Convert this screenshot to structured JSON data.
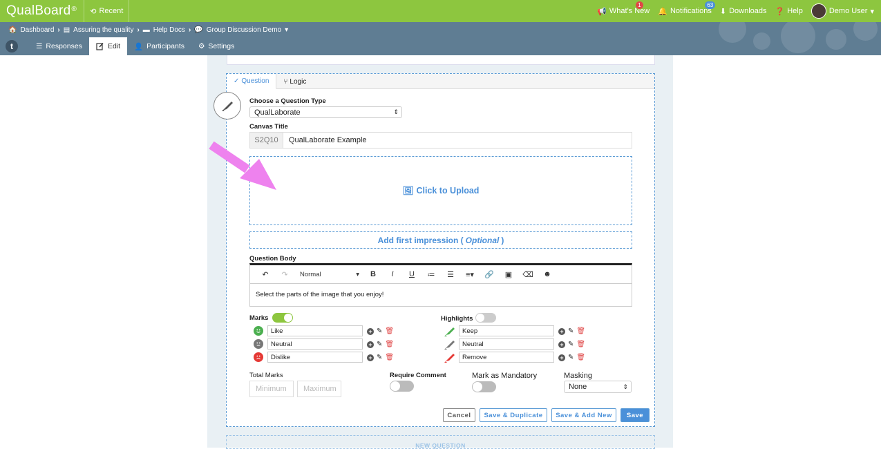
{
  "app": {
    "logo": "QualBoard",
    "logo_mark": "®",
    "recent": "Recent"
  },
  "topnav": {
    "whats_new": "What's New",
    "whats_new_badge": "1",
    "notifications": "Notifications",
    "notifications_badge": "63",
    "downloads": "Downloads",
    "help": "Help",
    "user": "Demo User"
  },
  "breadcrumb": [
    "Dashboard",
    "Assuring the quality",
    "Help Docs",
    "Group Discussion Demo"
  ],
  "tabs": {
    "logo_letter": "t",
    "responses": "Responses",
    "edit": "Edit",
    "participants": "Participants",
    "settings": "Settings"
  },
  "question": {
    "tabs": [
      "Question",
      "Logic"
    ],
    "type_label": "Choose a Question Type",
    "type_value": "QualLaborate",
    "title_label": "Canvas Title",
    "title_prefix": "S2Q10",
    "title_value": "QualLaborate Example",
    "upload": "Click to Upload",
    "impression_prefix": "Add first impression (",
    "impression_optional": "Optional",
    "impression_suffix": ")",
    "body_label": "Question Body",
    "format": "Normal",
    "body_text": "Select the parts of the image that you enjoy!"
  },
  "marks": {
    "label": "Marks",
    "enabled": true,
    "items": [
      {
        "label": "Like",
        "color": "#4caf50"
      },
      {
        "label": "Neutral",
        "color": "#777777"
      },
      {
        "label": "Dislike",
        "color": "#e53935"
      }
    ]
  },
  "highlights": {
    "label": "Highlights",
    "enabled": false,
    "items": [
      {
        "label": "Keep",
        "color": "#4caf50"
      },
      {
        "label": "Neutral",
        "color": "#777777"
      },
      {
        "label": "Remove",
        "color": "#e53935"
      }
    ]
  },
  "options": {
    "total_marks": "Total Marks",
    "min_placeholder": "Minimum",
    "max_placeholder": "Maximum",
    "require_comment": "Require Comment",
    "mandatory": "Mark as Mandatory",
    "masking": "Masking",
    "masking_value": "None"
  },
  "buttons": {
    "cancel": "Cancel",
    "save_duplicate": "Save & Duplicate",
    "save_add": "Save & Add New",
    "save": "Save"
  },
  "new_question": "NEW QUESTION",
  "colors": {
    "brand_green": "#8dc63f",
    "nav_blue": "#5f7d93",
    "accent_blue": "#4a90d9",
    "annotation_arrow": "#ee82ee"
  }
}
